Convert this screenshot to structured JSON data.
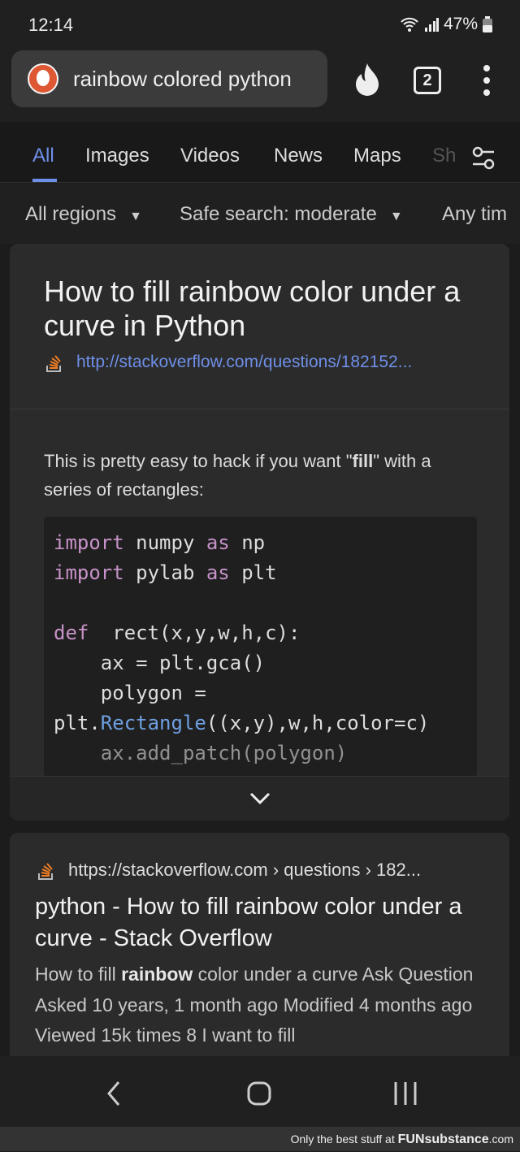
{
  "status": {
    "time": "12:14",
    "battery": "47%"
  },
  "search": {
    "query": "rainbow colored python",
    "tab_count": "2"
  },
  "tabs": [
    {
      "label": "All",
      "active": true
    },
    {
      "label": "Images"
    },
    {
      "label": "Videos"
    },
    {
      "label": "News"
    },
    {
      "label": "Maps"
    },
    {
      "label": "Sh"
    }
  ],
  "filters": {
    "region": "All regions",
    "safe": "Safe search: moderate",
    "time": "Any tim"
  },
  "answer": {
    "title": "How to fill rainbow color under a curve in Python",
    "link": "http://stackoverflow.com/questions/182152...",
    "snippet_pre": "This is pretty easy to hack if you want \"",
    "snippet_bold": "fill",
    "snippet_post": "\" with a series of rectangles:",
    "code": [
      [
        [
          "kw",
          "import"
        ],
        [
          "",
          "numpy "
        ],
        [
          "kw",
          "as"
        ],
        [
          "",
          " np"
        ]
      ],
      [
        [
          "kw",
          "import"
        ],
        [
          "",
          "pylab "
        ],
        [
          "kw",
          "as"
        ],
        [
          "",
          " plt"
        ]
      ],
      [
        [
          "",
          ""
        ]
      ],
      [
        [
          "kw",
          "def"
        ],
        [
          "",
          " rect(x,y,w,h,c):"
        ]
      ],
      [
        [
          "",
          "    ax = plt.gca()"
        ]
      ],
      [
        [
          "",
          "    polygon ="
        ]
      ],
      [
        [
          "",
          "plt."
        ],
        [
          "fn",
          "Rectangle"
        ],
        [
          "",
          "((x,y),w,h,color=c)"
        ]
      ],
      [
        [
          "",
          "    ax.add_patch(polygon)"
        ]
      ]
    ]
  },
  "result": {
    "url": "https://stackoverflow.com › questions › 182...",
    "title": "python - How to fill rainbow color under a curve - Stack Overflow",
    "snippet_pre": "How to fill ",
    "snippet_bold": "rainbow",
    "snippet_post": " color under a curve Ask Question Asked 10 years, 1 month ago Modified 4 months ago Viewed 15k times 8 I want to fill"
  },
  "watermark": {
    "pre": "Only the best stuff at ",
    "brand": "FUNsubstance",
    "post": ".com"
  },
  "colors": {
    "accent": "#6e8fe8",
    "keyword": "#c792c8",
    "stackoverflow": "#f48024",
    "ddg": "#de5833"
  }
}
